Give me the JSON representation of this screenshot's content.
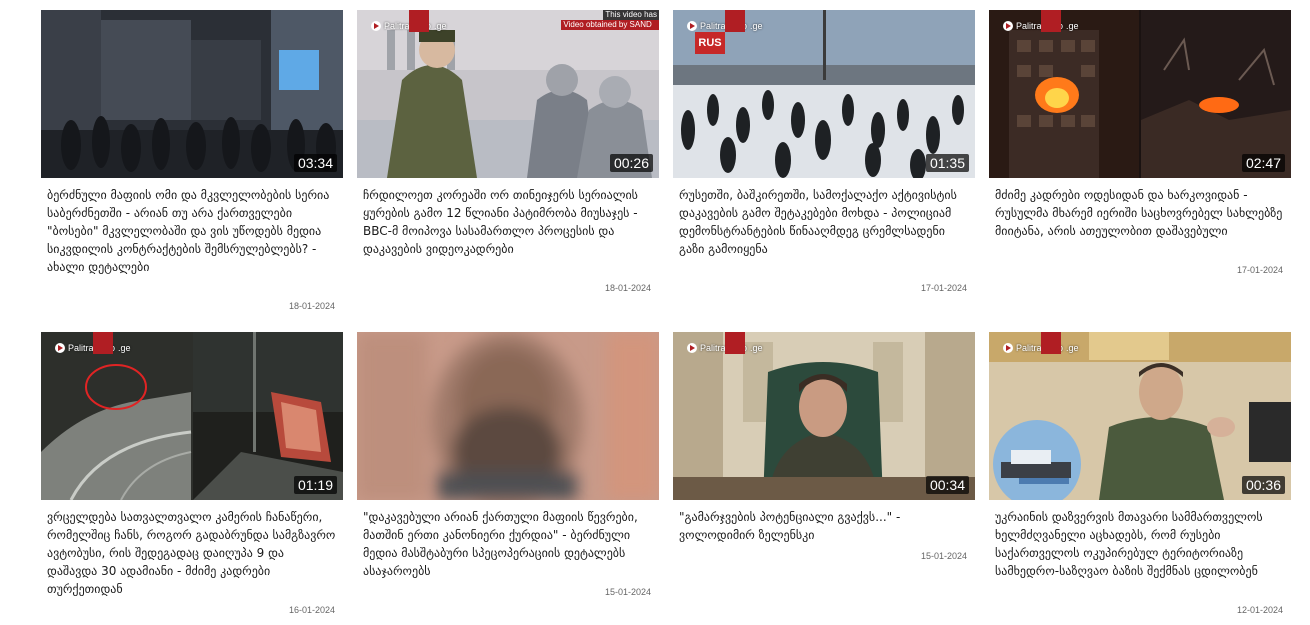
{
  "logo": {
    "text": "Palitravideo",
    "suffix": ".ge"
  },
  "videos": [
    {
      "duration": "03:34",
      "title": "ბერძნული მაფიის ომი და მკვლელობების სერია საბერძნეთში - არიან თუ არა ქართველები \"ბოსები\" მკვლელობაში და ვის უწოდებს მედია სიკვდილის კონტრაქტების შემსრულებლებს? - ახალი დეტალები",
      "date": "18-01-2024"
    },
    {
      "duration": "00:26",
      "title": "ჩრდილოეთ კორეაში ორ თინეიჯერს სერიალის ყურების გამო 12 წლიანი პატიმრობა მიუსაჯეს - BBC-მ მოიპოვა სასამართლო პროცესის და დაკავების ვიდეოკადრები",
      "date": "18-01-2024",
      "note_line1": "This video has",
      "note_line2": "Video obtained by SAND"
    },
    {
      "duration": "01:35",
      "title": "რუსეთში, ბაშკირეთში, სამოქალაქო აქტივისტის დაკავების გამო შეტაკებები მოხდა - პოლიციამ დემონსტრანტების წინააღმდეგ ცრემლსადენი გაზი გამოიყენა",
      "date": "17-01-2024",
      "badge": "RUS"
    },
    {
      "duration": "02:47",
      "title": "მძიმე კადრები ოდესიდან და ხარკოვიდან - რუსულმა მხარემ იერიში საცხოვრებელ სახლებზე მიიტანა, არის ათეულობით დაშავებული",
      "date": "17-01-2024"
    },
    {
      "duration": "01:19",
      "title": "ვრცელდება სათვალთვალო კამერის ჩანაწერი, რომელშიც ჩანს, როგორ გადაბრუნდა სამგზავრო ავტობუსი, რის შედეგადაც დაიღუპა 9 და დაშავდა 30 ადამიანი - მძიმე კადრები თურქეთიდან",
      "date": "16-01-2024"
    },
    {
      "duration": "",
      "title": "\"დაკავებული არიან ქართული მაფიის წევრები, მათშინ ერთი კანონიერი ქურდია\" - ბერძნული მედია მასშტაბური სპეცოპერაციის დეტალებს ასაჯაროებს",
      "date": "15-01-2024"
    },
    {
      "duration": "00:34",
      "title": "\"გამარჯვების პოტენციალი გვაქვს...\" - ვოლოდიმირ ზელენსკი",
      "date": "15-01-2024"
    },
    {
      "duration": "00:36",
      "title": "უკრაინის დაზვერვის მთავარი სამმართველოს ხელმძღვანელი აცხადებს, რომ რუსები საქართველოს ოკუპირებულ ტერიტორიაზე სამხედრო-საზღვაო ბაზის შექმნას ცდილობენ",
      "date": "12-01-2024"
    }
  ]
}
